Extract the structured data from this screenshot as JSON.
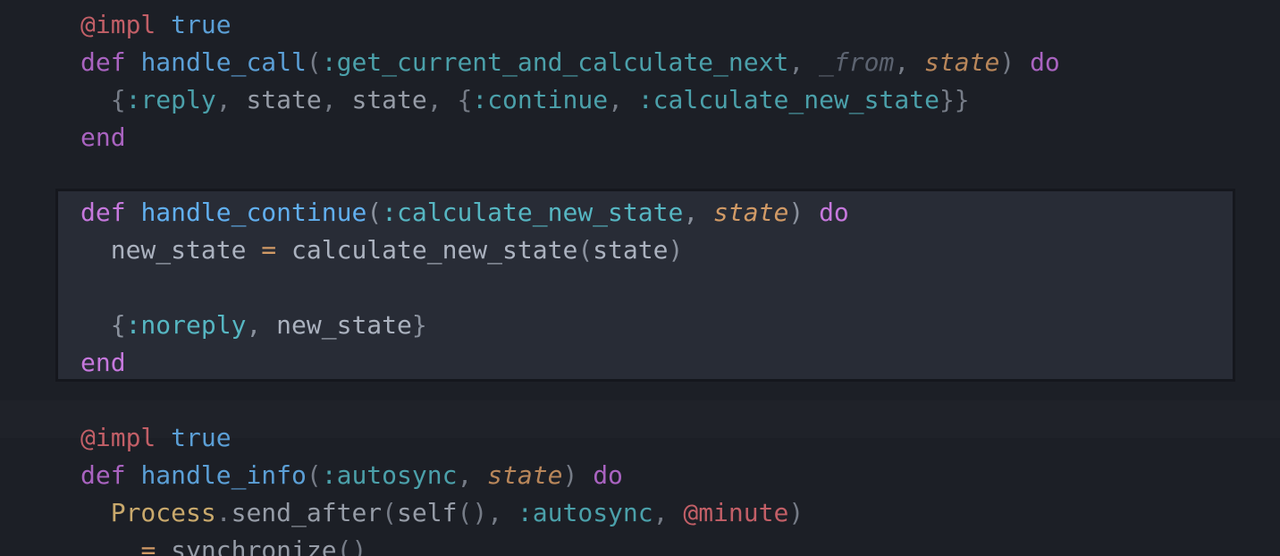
{
  "editor": {
    "language": "elixir",
    "lines": {
      "l1": {
        "attr": "@impl",
        "sp": " ",
        "val": "true"
      },
      "l2": {
        "kw": "def",
        "sp1": " ",
        "fn": "handle_call",
        "p1": "(",
        "atom": ":get_current_and_calculate_next",
        "c1": ", ",
        "unused": "_from",
        "c2": ", ",
        "param": "state",
        "p2": ")",
        "sp2": " ",
        "do": "do"
      },
      "l3": {
        "indent": "  ",
        "b1": "{",
        "atom1": ":reply",
        "c1": ", ",
        "v1": "state",
        "c2": ", ",
        "v2": "state",
        "c3": ", ",
        "b2": "{",
        "atom2": ":continue",
        "c4": ", ",
        "atom3": ":calculate_new_state",
        "b3": "}}"
      },
      "l4": {
        "end": "end"
      },
      "l6": {
        "kw": "def",
        "sp1": " ",
        "fn": "handle_continue",
        "p1": "(",
        "atom": ":calculate_new_state",
        "c1": ", ",
        "param": "state",
        "p2": ")",
        "sp2": " ",
        "do": "do"
      },
      "l7": {
        "indent": "  ",
        "var": "new_state",
        "eq": " = ",
        "call": "calculate_new_state",
        "p1": "(",
        "arg": "state",
        "p2": ")"
      },
      "l9": {
        "indent": "  ",
        "b1": "{",
        "atom": ":noreply",
        "c1": ", ",
        "var": "new_state",
        "b2": "}"
      },
      "l10": {
        "end": "end"
      },
      "l12": {
        "attr": "@impl",
        "sp": " ",
        "val": "true"
      },
      "l13": {
        "kw": "def",
        "sp1": " ",
        "fn": "handle_info",
        "p1": "(",
        "atom": ":autosync",
        "c1": ", ",
        "param": "state",
        "p2": ")",
        "sp2": " ",
        "do": "do"
      },
      "l14": {
        "indent": "  ",
        "mod": "Process",
        "dot": ".",
        "fn": "send_after",
        "p1": "(",
        "self": "self",
        "pp": "()",
        "c1": ", ",
        "atom": ":autosync",
        "c2": ", ",
        "attr": "@minute",
        "p2": ")"
      },
      "l15": {
        "indent": "    ",
        "eq": "= ",
        "call": "synchronize",
        "pp": "()"
      }
    }
  },
  "colors": {
    "background": "#1c1f26",
    "focus_block": "#282c36",
    "keyword": "#c678dd",
    "attribute": "#e06c75",
    "function": "#61afef",
    "atom": "#56b6c2",
    "parameter": "#d19a66",
    "module": "#e5c07b"
  }
}
